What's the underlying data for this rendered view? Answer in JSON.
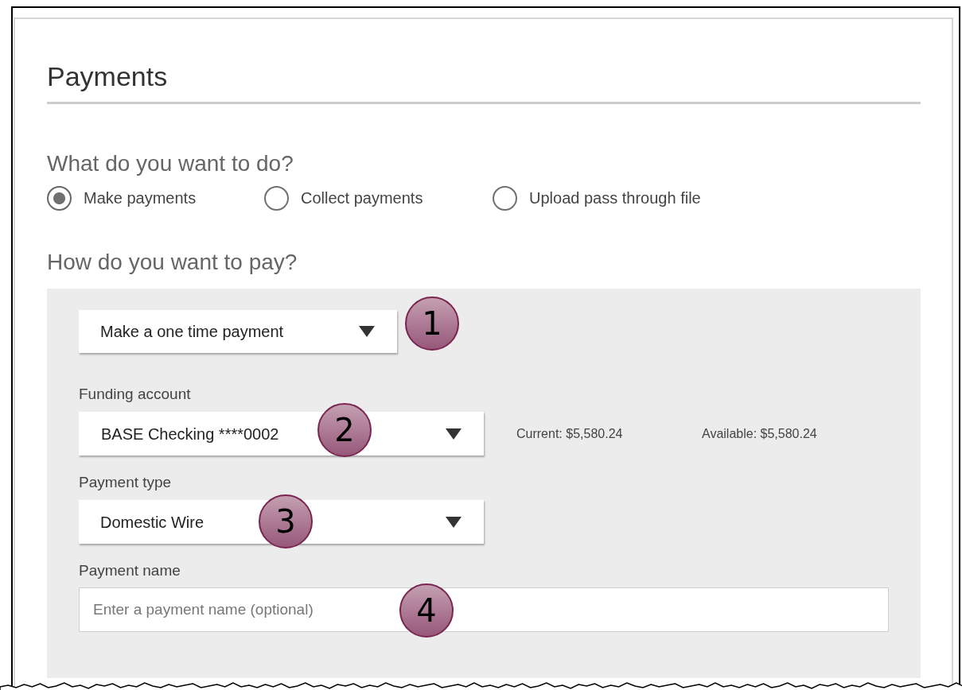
{
  "page": {
    "title": "Payments"
  },
  "action": {
    "question": "What do you want to do?",
    "options": [
      {
        "label": "Make payments",
        "selected": true
      },
      {
        "label": "Collect payments",
        "selected": false
      },
      {
        "label": "Upload pass through file",
        "selected": false
      }
    ]
  },
  "payment": {
    "question": "How do you want to pay?",
    "method": {
      "value": "Make a one time payment"
    },
    "funding_account": {
      "label": "Funding account",
      "value": "BASE Checking ****0002",
      "current": "Current: $5,580.24",
      "available": "Available: $5,580.24"
    },
    "payment_type": {
      "label": "Payment type",
      "value": "Domestic Wire"
    },
    "payment_name": {
      "label": "Payment name",
      "placeholder": "Enter a payment name (optional)"
    }
  },
  "callouts": [
    "1",
    "2",
    "3",
    "4"
  ]
}
